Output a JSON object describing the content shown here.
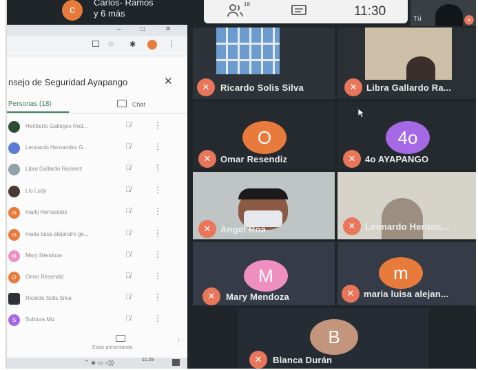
{
  "colors": {
    "mic_badge": "#e9765a",
    "avatar_orange": "#e87b3b",
    "avatar_purple": "#a569e6",
    "avatar_pink": "#ef8fc0",
    "avatar_brown": "#c3957d",
    "panel_accent": "#3e7d5a"
  },
  "top_banner": {
    "avatar_letter": "c",
    "line1": "Carlos- Ramos",
    "line2": "y 6 más"
  },
  "meet_controls": {
    "participants_icon": "people-icon",
    "participant_count": "18",
    "chat_icon": "chat-icon",
    "time": "11:30"
  },
  "self_tile": {
    "label": "Tú"
  },
  "browser": {
    "window_controls": [
      "–",
      "□",
      "✕"
    ],
    "toolbar_icons": [
      "cast-icon",
      "star-icon",
      "extension-icon",
      "profile-icon",
      "more-icon"
    ]
  },
  "side_panel": {
    "title": "nsejo de Seguridad Ayapango",
    "close_label": "✕",
    "tab_people": "Personas (18)",
    "tab_chat": "Chat",
    "participants": [
      {
        "initial": "",
        "name": "Heriberto Gallegos Rod...",
        "color": "#2e4d33"
      },
      {
        "initial": "",
        "name": "Leonardo Hernandez G...",
        "color": "#5c7bd6"
      },
      {
        "initial": "",
        "name": "Libra Gallardo Ramirez",
        "color": "#8fa3a6"
      },
      {
        "initial": "",
        "name": "Lio Ludy",
        "color": "#4a3a34"
      },
      {
        "initial": "m",
        "name": "marlij Hernandez",
        "color": "#e87b3b"
      },
      {
        "initial": "m",
        "name": "maria luisa alejandro ge...",
        "color": "#e87b3b"
      },
      {
        "initial": "M",
        "name": "Mary Mendoza",
        "color": "#ef8fc0"
      },
      {
        "initial": "O",
        "name": "Omar Resendiz",
        "color": "#e87b3b"
      },
      {
        "initial": "",
        "name": "Ricardo Solis Silva",
        "color": "#2f3238"
      },
      {
        "initial": "S",
        "name": "Subtura Miz",
        "color": "#a569e6"
      }
    ],
    "presenting_icon": "present-icon",
    "presenting_label": "Estás presentando",
    "taskbar_time": "11:29"
  },
  "tiles": {
    "ricardo": "Ricardo Solis Silva",
    "libra": "Libra Gallardo Ra...",
    "omar": {
      "initial": "O",
      "name": "Omar Resendiz"
    },
    "ayapango": {
      "initial": "4o",
      "name": "4o AYAPANGO"
    },
    "angel": "Angel Roa",
    "leonardo": "Leonardo Hernan...",
    "mary": {
      "initial": "M",
      "name": "Mary Mendoza"
    },
    "maria": {
      "initial": "m",
      "name": "maria luisa alejan..."
    },
    "blanca": {
      "initial": "B",
      "name": "Blanca Durán"
    }
  }
}
